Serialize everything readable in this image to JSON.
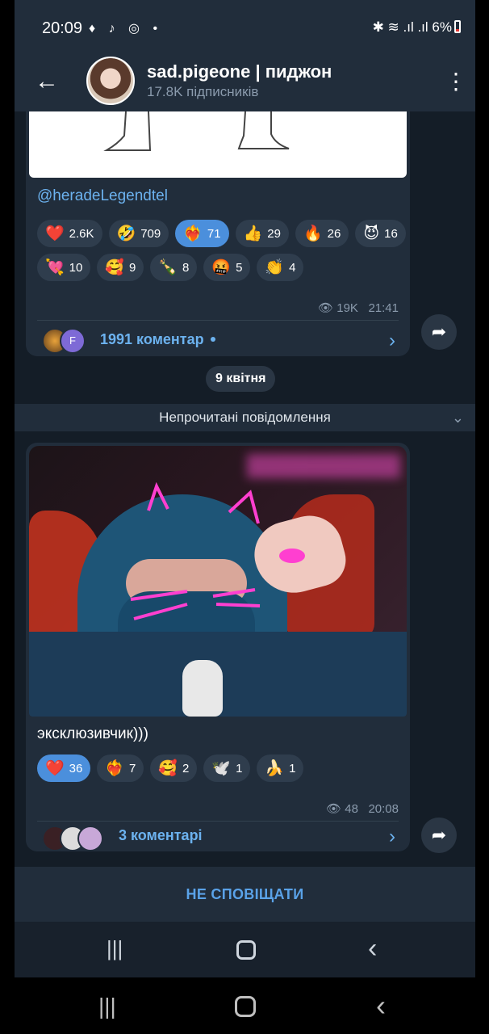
{
  "status_bar": {
    "time": "20:09",
    "app_icons": "♦ ♪ ◎ •",
    "right": "✱ ≋ .ıl .ıl",
    "battery": "6%"
  },
  "header": {
    "back_icon": "arrow-left-icon",
    "title": "sad.pigeone | пиджон",
    "subtitle": "17.8K підписників",
    "menu_icon": "more-vertical-icon"
  },
  "post1": {
    "link": "@heradeLegendtel",
    "reactions": [
      {
        "emoji": "❤️",
        "count": "2.6K",
        "active": false
      },
      {
        "emoji": "🤣",
        "count": "709",
        "active": false
      },
      {
        "emoji": "❤️‍🔥",
        "count": "71",
        "active": true
      },
      {
        "emoji": "👍",
        "count": "29",
        "active": false
      },
      {
        "emoji": "🔥",
        "count": "26",
        "active": false
      },
      {
        "emoji": "😈",
        "count": "16",
        "active": false
      },
      {
        "emoji": "💘",
        "count": "10",
        "active": false
      },
      {
        "emoji": "🥰",
        "count": "9",
        "active": false
      },
      {
        "emoji": "🍾",
        "count": "8",
        "active": false
      },
      {
        "emoji": "🤬",
        "count": "5",
        "active": false
      },
      {
        "emoji": "👏",
        "count": "4",
        "active": false
      }
    ],
    "views": "19K",
    "time": "21:41",
    "comments_label": "1991 коментар",
    "avatar_letter": "F"
  },
  "date_separator": "9 квітня",
  "unread_label": "Непрочитані повідомлення",
  "post2": {
    "caption": "эксклюзивчик)))",
    "reactions": [
      {
        "emoji": "❤️",
        "count": "36",
        "active": true
      },
      {
        "emoji": "❤️‍🔥",
        "count": "7",
        "active": false
      },
      {
        "emoji": "🥰",
        "count": "2",
        "active": false
      },
      {
        "emoji": "🕊️",
        "count": "1",
        "active": false
      },
      {
        "emoji": "🍌",
        "count": "1",
        "active": false
      }
    ],
    "views": "48",
    "time": "20:08",
    "comments_label": "3 коментарі"
  },
  "mute_label": "НЕ СПОВІЩАТИ",
  "icons": {
    "eye": "👁",
    "share": "➦",
    "chevron_right": "›",
    "chevron_down": "⌄",
    "nav_recents": "|||",
    "nav_back": "‹"
  }
}
